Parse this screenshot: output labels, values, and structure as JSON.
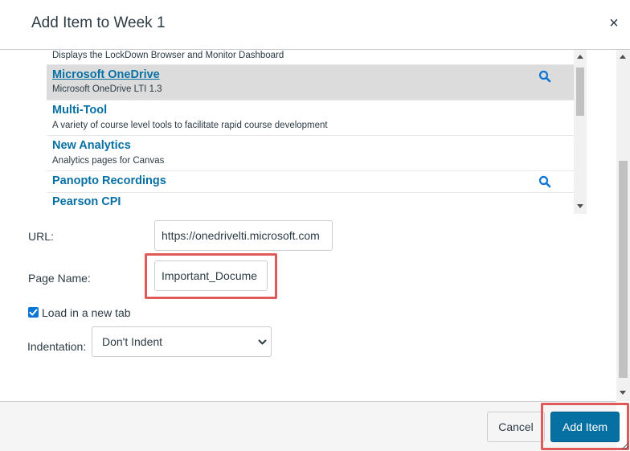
{
  "dialog": {
    "title": "Add Item to Week 1",
    "close_icon": "close-icon"
  },
  "tool_list": {
    "items": [
      {
        "name": "",
        "description": "Displays the LockDown Browser and Monitor Dashboard",
        "selected": false,
        "has_search_icon": false
      },
      {
        "name": "Microsoft OneDrive",
        "description": "Microsoft OneDrive LTI 1.3",
        "selected": true,
        "has_search_icon": true
      },
      {
        "name": "Multi-Tool",
        "description": "A variety of course level tools to facilitate rapid course development",
        "selected": false,
        "has_search_icon": false
      },
      {
        "name": "New Analytics",
        "description": "Analytics pages for Canvas",
        "selected": false,
        "has_search_icon": false
      },
      {
        "name": "Panopto Recordings",
        "description": "",
        "selected": false,
        "has_search_icon": true
      },
      {
        "name": "Pearson CPI",
        "description": "",
        "selected": false,
        "has_search_icon": false
      }
    ],
    "icon": "search-icon"
  },
  "form": {
    "url_label": "URL:",
    "url_value": "https://onedrivelti.microsoft.com",
    "page_name_label": "Page Name:",
    "page_name_value": "Important_Docume",
    "load_new_tab_label": "Load in a new tab",
    "load_new_tab_checked": true,
    "indentation_label": "Indentation:",
    "indentation_value": "Don't Indent"
  },
  "footer": {
    "cancel_label": "Cancel",
    "add_item_label": "Add Item"
  },
  "colors": {
    "link": "#0770a3",
    "primary_button": "#0770a3",
    "highlight_box": "#e05a5a",
    "selected_row": "#dcdcdc",
    "checkbox": "#0b76d6"
  }
}
